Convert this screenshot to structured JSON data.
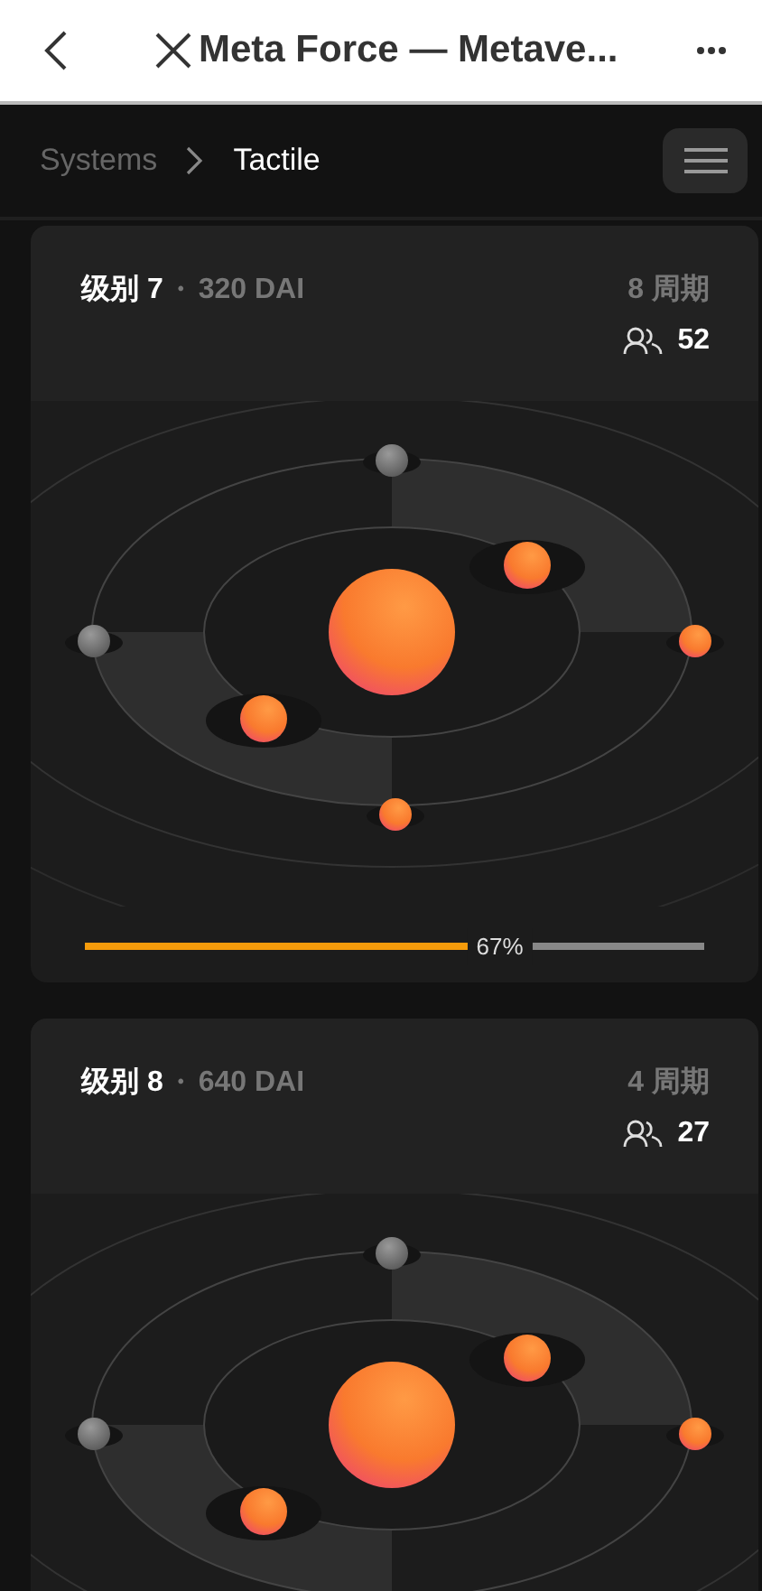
{
  "browser": {
    "title": "Meta Force — Metave..."
  },
  "breadcrumb": [
    {
      "label": "Systems",
      "selected": false
    },
    {
      "label": "Tactile",
      "selected": true
    }
  ],
  "levels": [
    {
      "level_label": "级别 7",
      "separator": "•",
      "price": "320 DAI",
      "cycles": "8 周期",
      "members": "52",
      "planets": [
        {
          "active": false
        },
        {
          "active": true
        },
        {
          "active": true
        },
        {
          "active": false
        },
        {
          "active": true
        },
        {
          "active": true
        }
      ],
      "progress": {
        "level": 0.67,
        "reading": "67%"
      }
    },
    {
      "level_label": "级别 8",
      "separator": "•",
      "price": "640 DAI",
      "cycles": "4 周期",
      "members": "27",
      "planets": [
        {
          "active": false
        },
        {
          "active": true
        },
        {
          "active": true
        },
        {
          "active": false
        },
        {
          "active": true
        }
      ]
    }
  ]
}
